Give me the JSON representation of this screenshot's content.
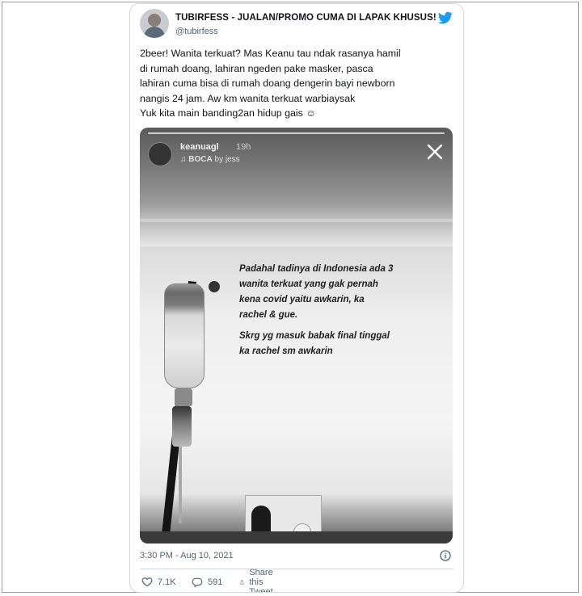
{
  "tweet": {
    "display_name": "TUBIRFESS - JUALAN/PROMO CUMA DI LAPAK KHUSUS!",
    "handle": "@tubirfess",
    "text_lines": [
      "2beer! Wanita terkuat? Mas Keanu tau ndak rasanya hamil",
      "di rumah doang, lahiran ngeden pake masker, pasca",
      "lahiran cuma bisa di rumah doang dengerin bayi newborn",
      "nangis 24 jam. Aw km wanita terkuat warbiaysak",
      "Yuk kita main banding2an hidup gais ☺"
    ],
    "timestamp": "3:30 PM - Aug 10, 2021",
    "likes": "7.1K",
    "replies": "591",
    "share_label": "Share this Tweet"
  },
  "story": {
    "username": "keanuagl",
    "time": "19h",
    "music_title": "BOCA",
    "music_artist": "by jess",
    "caption_lines_1": [
      "Padahal tadinya di Indonesia ada 3",
      "wanita terkuat yang gak pernah",
      "kena covid yaitu awkarin, ka",
      "rachel & gue."
    ],
    "caption_lines_2": [
      "Skrg yg masuk babak final tinggal",
      "ka rachel sm awkarin"
    ]
  },
  "colors": {
    "twitter_blue": "#1d9bf0",
    "text_primary": "#0f1419",
    "text_secondary": "#536471",
    "border": "#cfd9de"
  },
  "icons": {
    "logo": "twitter-bird-icon",
    "close": "close-icon",
    "info": "info-icon",
    "like": "heart-icon",
    "reply": "reply-icon",
    "share": "share-icon",
    "music": "music-note-icon"
  }
}
